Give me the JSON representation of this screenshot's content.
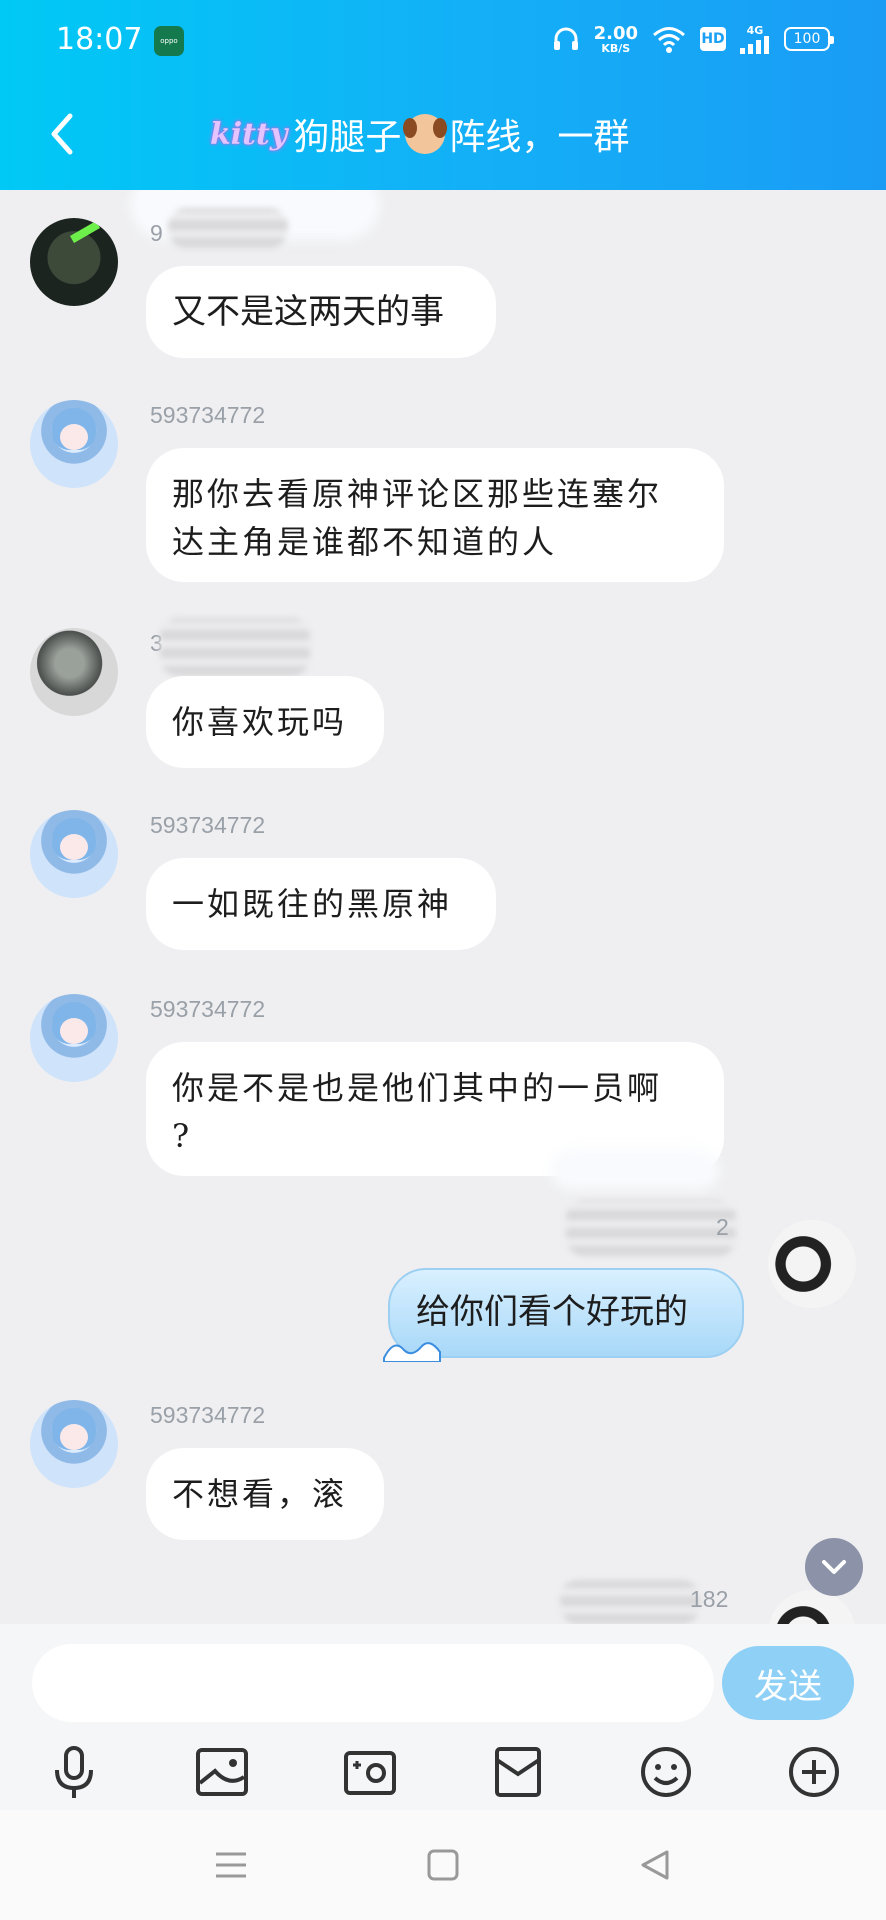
{
  "status_bar": {
    "time": "18:07",
    "app_badge": "oppo",
    "speed_value": "2.00",
    "speed_unit": "KB/S",
    "hd": "HD",
    "net": "4G",
    "battery": "100"
  },
  "header": {
    "title_tag": "kitty",
    "title_part1": "狗腿子",
    "title_part2": "阵线，一群",
    "title_emoji": "dog-face-icon"
  },
  "messages": [
    {
      "sender": "9",
      "text": "又不是这两天的事"
    },
    {
      "sender": "593734772",
      "text_line1": "那你去看原神评论区那些连塞尔",
      "text_line2": "达主角是谁都不知道的人"
    },
    {
      "sender": "3",
      "text": "你喜欢玩吗"
    },
    {
      "sender": "593734772",
      "text": "一如既往的黑原神"
    },
    {
      "sender": "593734772",
      "text_line1": "你是不是也是他们其中的一员啊",
      "text_line2": "?"
    },
    {
      "sender": "2",
      "text": "给你们看个好玩的",
      "mine": true
    },
    {
      "sender": "593734772",
      "text": "不想看，滚"
    },
    {
      "sender": "182"
    }
  ],
  "input": {
    "placeholder": "",
    "send_label": "发送"
  },
  "toolbar": [
    "microphone-icon",
    "image-icon",
    "camera-icon",
    "red-packet-icon",
    "emoji-icon",
    "plus-circle-icon"
  ],
  "navbar": [
    "menu-icon",
    "home-icon",
    "back-triangle-icon"
  ],
  "colors": {
    "header_start": "#00c9f5",
    "header_end": "#1a9cf5",
    "send_button": "#8fd0f7",
    "chat_bg": "#efeff1"
  }
}
